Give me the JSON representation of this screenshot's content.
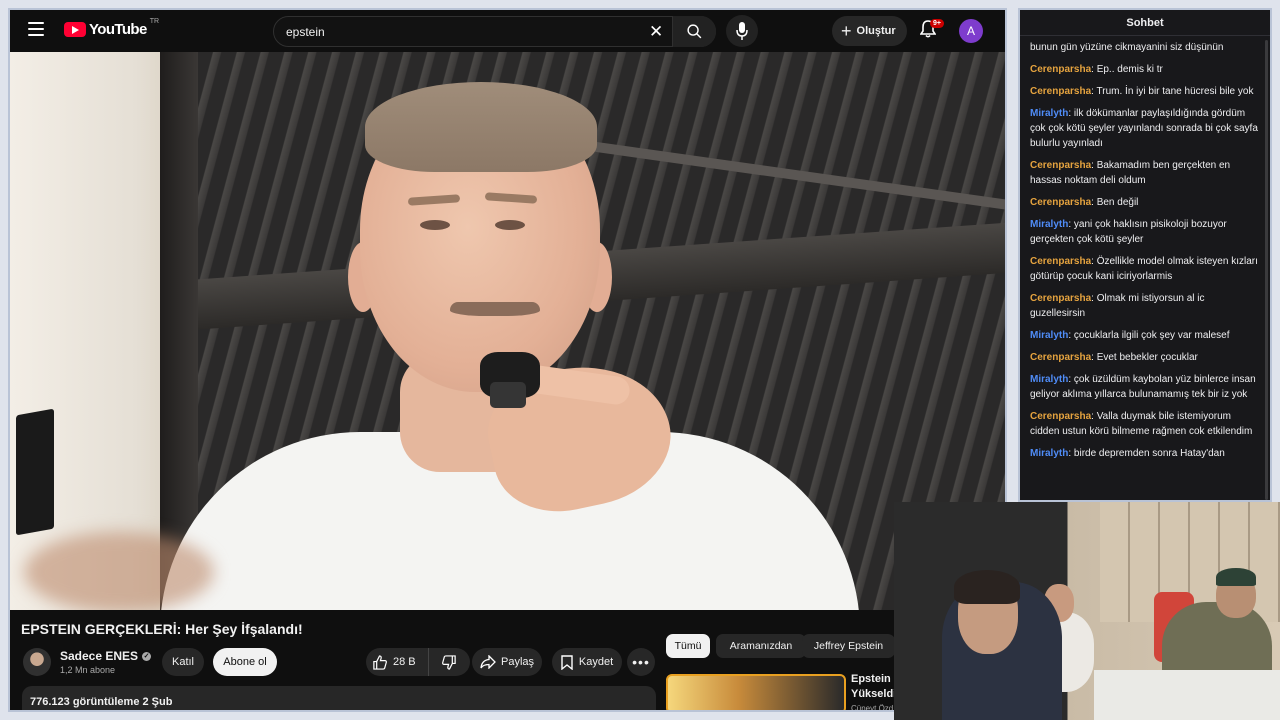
{
  "masthead": {
    "logo_text": "YouTube",
    "logo_country": "TR",
    "search_value": "epstein",
    "create_label": "Oluştur",
    "notification_count": "9+",
    "avatar_letter": "A"
  },
  "video": {
    "title": "EPSTEIN GERÇEKLERİ: Her Şey İfşalandı!",
    "channel_name": "Sadece ENES",
    "subscribers": "1,2 Mn abone",
    "join_label": "Katıl",
    "subscribe_label": "Abone ol",
    "like_count": "28 B",
    "share_label": "Paylaş",
    "save_label": "Kaydet",
    "views_date": "776.123 görüntüleme  2 Şub"
  },
  "chips": [
    "Tümü",
    "Aramanızdan",
    "Jeffrey Epstein"
  ],
  "recommendation": {
    "title_line1": "Epstein K",
    "title_line2": "Yükseldi,",
    "channel": "Cüneyt Özd"
  },
  "chat": {
    "header": "Sohbet",
    "colors": {
      "Cerenparsha": "#e5a33f",
      "Miralyth": "#4f8cf7"
    },
    "messages": [
      {
        "user": "",
        "text": "bunun gün yüzüne cikmayanini siz düşünün"
      },
      {
        "user": "Cerenparsha",
        "text": "Ep.. demis ki tr"
      },
      {
        "user": "Cerenparsha",
        "text": "Trum. İn iyi bir tane hücresi bile yok"
      },
      {
        "user": "Miralyth",
        "text": "ilk dökümanlar paylaşıldığında gördüm çok çok kötü şeyler yayınlandı sonrada bi çok sayfa bulurlu yayınladı"
      },
      {
        "user": "Cerenparsha",
        "text": "Bakamadım ben gerçekten en hassas noktam deli oldum"
      },
      {
        "user": "Cerenparsha",
        "text": "Ben değil"
      },
      {
        "user": "Miralyth",
        "text": "yani çok haklısın pisikoloji bozuyor gerçekten çok kötü şeyler"
      },
      {
        "user": "Cerenparsha",
        "text": "Özellikle model olmak isteyen kızları götürüp çocuk kani iciriyorlarmis"
      },
      {
        "user": "Cerenparsha",
        "text": "Olmak mi istiyorsun al ic guzellesirsin"
      },
      {
        "user": "Miralyth",
        "text": "çocuklarla ilgili çok şey var malesef"
      },
      {
        "user": "Cerenparsha",
        "text": "Evet bebekler çocuklar"
      },
      {
        "user": "Miralyth",
        "text": "çok üzüldüm kaybolan yüz binlerce insan geliyor aklıma yıllarca bulunamamış tek bir iz yok"
      },
      {
        "user": "Cerenparsha",
        "text": "Valla duymak bile istemiyorum cidden ustun körü bilmeme rağmen cok etkilendim"
      },
      {
        "user": "Miralyth",
        "text": "birde depremden sonra Hatay'dan"
      }
    ]
  }
}
